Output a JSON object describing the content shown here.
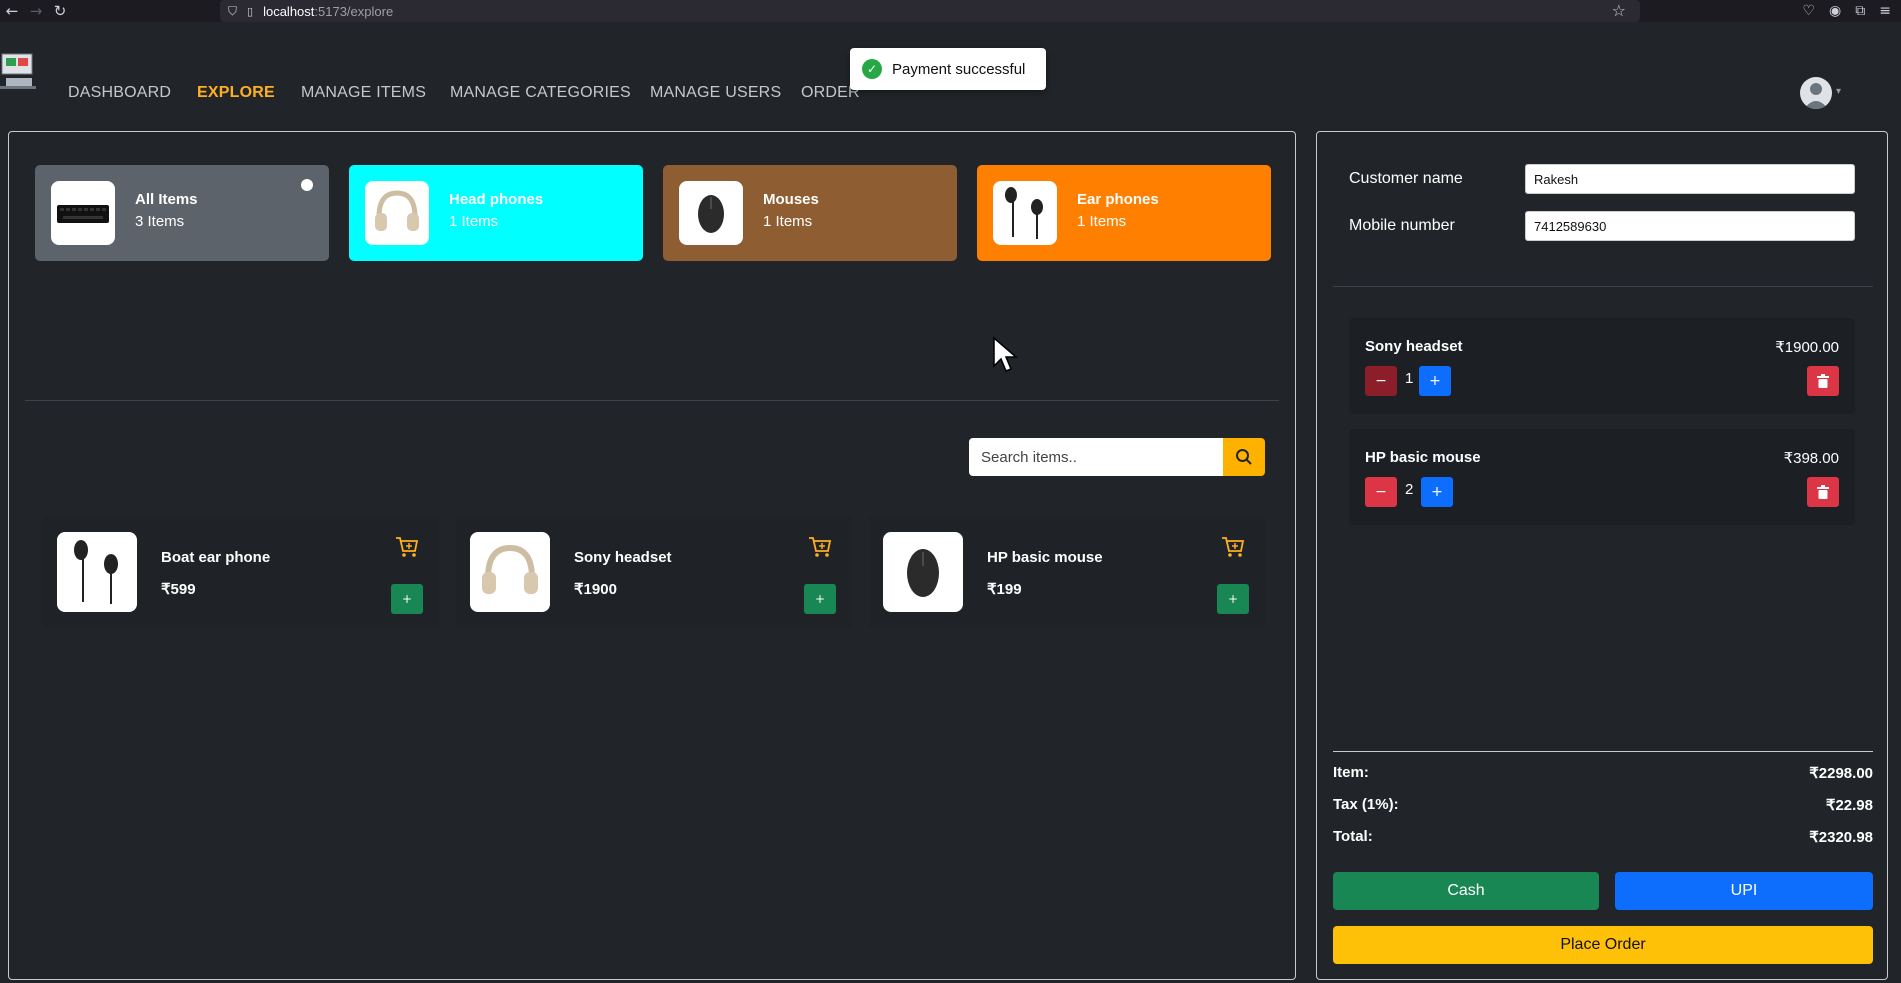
{
  "browser": {
    "url_host": "localhost",
    "url_rest": ":5173/explore"
  },
  "nav": {
    "links": [
      "DASHBOARD",
      "EXPLORE",
      "MANAGE ITEMS",
      "MANAGE CATEGORIES",
      "MANAGE USERS",
      "ORDER"
    ],
    "active": "EXPLORE"
  },
  "toast": {
    "message": "Payment successful"
  },
  "categories": [
    {
      "name": "All Items",
      "count": "3 Items",
      "color": "#5d636b",
      "icon": "keyboard-icon"
    },
    {
      "name": "Head phones",
      "count": "1 Items",
      "color": "#00ffff",
      "icon": "headphones-icon"
    },
    {
      "name": "Mouses",
      "count": "1 Items",
      "color": "#8e5e32",
      "icon": "mouse-icon"
    },
    {
      "name": "Ear phones",
      "count": "1 Items",
      "color": "#ff7f00",
      "icon": "earphones-icon"
    }
  ],
  "search": {
    "placeholder": "Search items.."
  },
  "items": [
    {
      "name": "Boat ear phone",
      "price": "₹599"
    },
    {
      "name": "Sony headset",
      "price": "₹1900"
    },
    {
      "name": "HP basic mouse",
      "price": "₹199"
    }
  ],
  "customer": {
    "name_label": "Customer name",
    "name_value": "Rakesh",
    "mobile_label": "Mobile number",
    "mobile_value": "7412589630"
  },
  "cart": [
    {
      "name": "Sony headset",
      "price": "₹1900.00",
      "qty": "1",
      "minus_color": "#8b1e28"
    },
    {
      "name": "HP basic mouse",
      "price": "₹398.00",
      "qty": "2",
      "minus_color": "#dc3545"
    }
  ],
  "summary": {
    "item_label": "Item:",
    "item_value": "₹2298.00",
    "tax_label": "Tax (1%):",
    "tax_value": "₹22.98",
    "total_label": "Total:",
    "total_value": "₹2320.98"
  },
  "buttons": {
    "cash": "Cash",
    "upi": "UPI",
    "place_order": "Place Order"
  },
  "colors": {
    "accent": "#ffb020",
    "success": "#198754",
    "primary": "#0d6efd",
    "danger": "#dc3545",
    "warning": "#ffc107"
  }
}
